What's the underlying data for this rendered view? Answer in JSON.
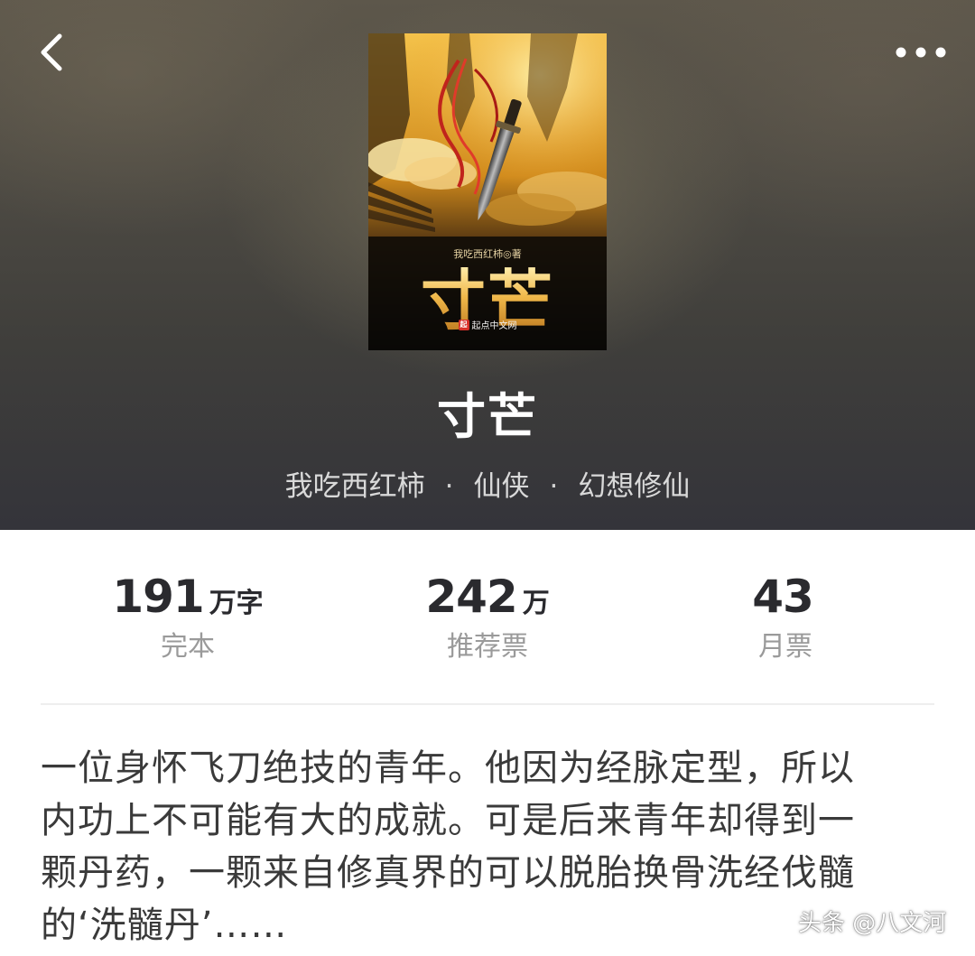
{
  "header": {
    "cover": {
      "author_line": "我吃西红柿◎著",
      "title": "寸芒",
      "publisher_badge": "起",
      "publisher": "起点中文网"
    },
    "title": "寸芒",
    "meta": {
      "author": "我吃西红柿",
      "separator": "·",
      "category": "仙侠",
      "subcategory": "幻想修仙"
    },
    "icons": [
      "chevron-left-icon",
      "more-dots-icon"
    ]
  },
  "stats": [
    {
      "value": "191",
      "unit": "万字",
      "label": "完本"
    },
    {
      "value": "242",
      "unit": "万",
      "label": "推荐票"
    },
    {
      "value": "43",
      "unit": "",
      "label": "月票"
    }
  ],
  "description": {
    "line1": "一位身怀飞刀绝技的青年。他因为经脉定型，所以",
    "line2": "内功上不可能有大的成就。可是后来青年却得到一",
    "line3": "颗丹药，一颗来自修真界的可以脱胎换骨洗经伐髓",
    "line4": "的‘洗髓丹’……"
  },
  "watermark": "头条 @八文河",
  "colors": {
    "header_bg": "#4a4843",
    "title_text": "#ffffff",
    "meta_text": "#d9d9d9",
    "stat_value": "#2a2a2e",
    "stat_label": "#9a9a9a",
    "body_text": "#3a3a3a",
    "cover_title_gold": "#e9b44c",
    "publisher_red": "#d7312a"
  }
}
